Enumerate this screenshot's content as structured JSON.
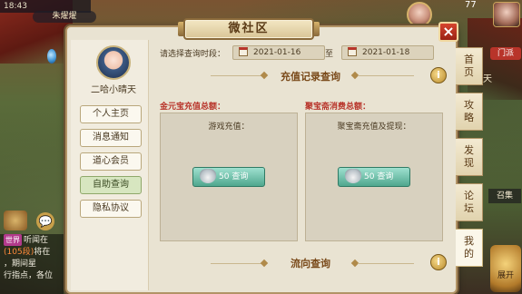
{
  "hud": {
    "time": "18:43",
    "player_pill": "朱燿燿",
    "level": "77",
    "red_badge": "门派",
    "right_text": "天",
    "mid_btn": "召集",
    "bottom_btn": "展开"
  },
  "chat": {
    "lines": [
      {
        "tag": "世界",
        "text": "听闻在"
      },
      {
        "highlight": "(105段)",
        "text": "将在"
      },
      {
        "text": "，期间星"
      },
      {
        "text": "行指点，各位"
      }
    ]
  },
  "panel": {
    "title": "微社区",
    "close_label": "×",
    "profile": {
      "name": "二哈小晴天"
    },
    "nav": [
      {
        "label": "个人主页"
      },
      {
        "label": "消息通知"
      },
      {
        "label": "道心会员"
      },
      {
        "label": "自助查询",
        "active": true
      },
      {
        "label": "隐私协议"
      }
    ],
    "query": {
      "label": "请选择查询时段：",
      "start_date": "2021-01-16",
      "end_date": "2021-01-18",
      "separator": "至"
    },
    "sections": {
      "recharge_title": "充值记录查询",
      "flow_title": "流向查询",
      "info_label": "i"
    },
    "stats": {
      "left_label": "金元宝充值总额：",
      "left_header": "游戏充值：",
      "left_button": "50 查询",
      "right_label": "聚宝斋消费总额：",
      "right_header": "聚宝斋充值及提现：",
      "right_button": "50 查询"
    },
    "side_tabs": [
      {
        "label": "首\n页",
        "active": false
      },
      {
        "label": "攻\n略",
        "active": false
      },
      {
        "label": "发\n现",
        "active": false
      },
      {
        "label": "论\n坛",
        "active": false
      },
      {
        "label": "我\n的",
        "active": true
      }
    ]
  }
}
